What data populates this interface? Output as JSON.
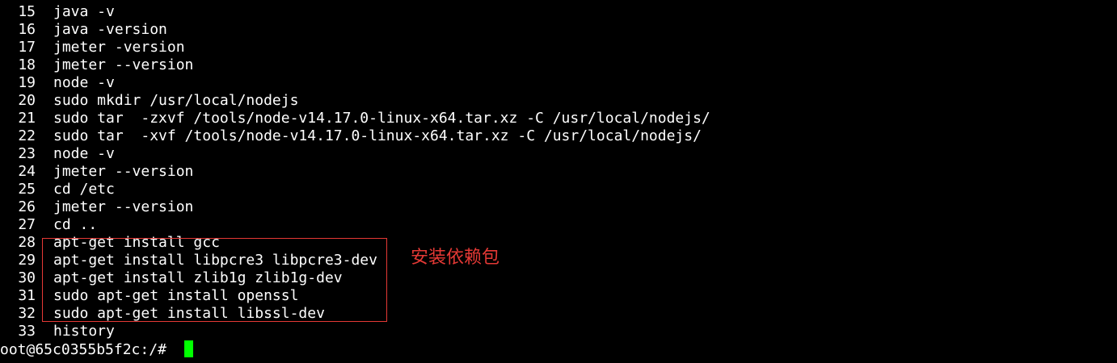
{
  "colors": {
    "background": "#000000",
    "text": "#ffffff",
    "cursor": "#00ff00",
    "annotation": "#e53935",
    "box": "#e53935"
  },
  "history": [
    {
      "num": "15",
      "cmd": "java -v"
    },
    {
      "num": "16",
      "cmd": "java -version"
    },
    {
      "num": "17",
      "cmd": "jmeter -version"
    },
    {
      "num": "18",
      "cmd": "jmeter --version"
    },
    {
      "num": "19",
      "cmd": "node -v"
    },
    {
      "num": "20",
      "cmd": "sudo mkdir /usr/local/nodejs"
    },
    {
      "num": "21",
      "cmd": "sudo tar  -zxvf /tools/node-v14.17.0-linux-x64.tar.xz -C /usr/local/nodejs/"
    },
    {
      "num": "22",
      "cmd": "sudo tar  -xvf /tools/node-v14.17.0-linux-x64.tar.xz -C /usr/local/nodejs/"
    },
    {
      "num": "23",
      "cmd": "node -v"
    },
    {
      "num": "24",
      "cmd": "jmeter --version"
    },
    {
      "num": "25",
      "cmd": "cd /etc"
    },
    {
      "num": "26",
      "cmd": "jmeter --version"
    },
    {
      "num": "27",
      "cmd": "cd .."
    },
    {
      "num": "28",
      "cmd": "apt-get install gcc"
    },
    {
      "num": "29",
      "cmd": "apt-get install libpcre3 libpcre3-dev"
    },
    {
      "num": "30",
      "cmd": "apt-get install zlib1g zlib1g-dev"
    },
    {
      "num": "31",
      "cmd": "sudo apt-get install openssl"
    },
    {
      "num": "32",
      "cmd": "sudo apt-get install libssl-dev"
    },
    {
      "num": "33",
      "cmd": "history"
    }
  ],
  "prompt": "oot@65c0355b5f2c:/# ",
  "annotation": "安装依赖包"
}
